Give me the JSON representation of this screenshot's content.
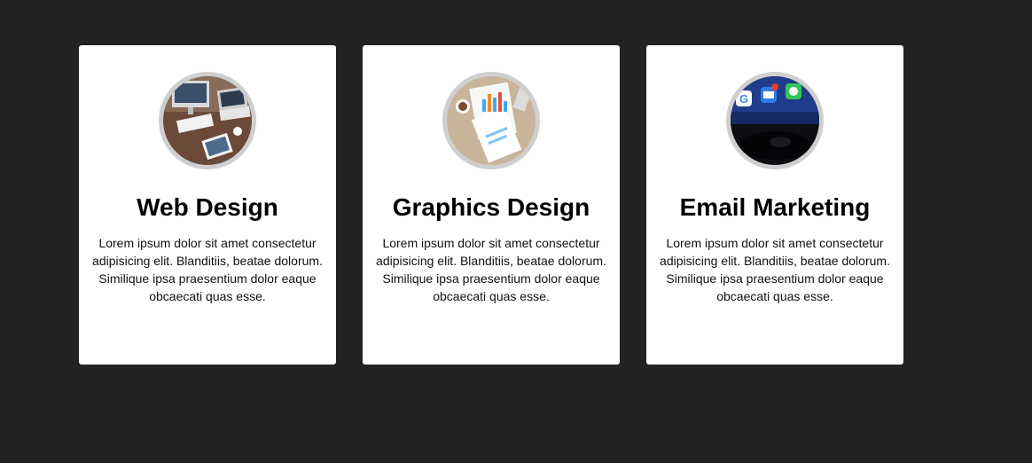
{
  "cards": [
    {
      "image": "workspace-desk-photo",
      "title": "Web Design",
      "text": "Lorem ipsum dolor sit amet consectetur adipisicing elit. Blanditiis, beatae dolorum. Similique ipsa praesentium dolor eaque obcaecati quas esse."
    },
    {
      "image": "analytics-charts-photo",
      "title": "Graphics Design",
      "text": "Lorem ipsum dolor sit amet consectetur adipisicing elit. Blanditiis, beatae dolorum. Similique ipsa praesentium dolor eaque obcaecati quas esse."
    },
    {
      "image": "smartphone-apps-photo",
      "title": "Email Marketing",
      "text": "Lorem ipsum dolor sit amet consectetur adipisicing elit. Blanditiis, beatae dolorum. Similique ipsa praesentium dolor eaque obcaecati quas esse."
    }
  ],
  "colors": {
    "page_background": "#232323",
    "card_background": "#ffffff",
    "avatar_ring": "#cfcfcf"
  }
}
